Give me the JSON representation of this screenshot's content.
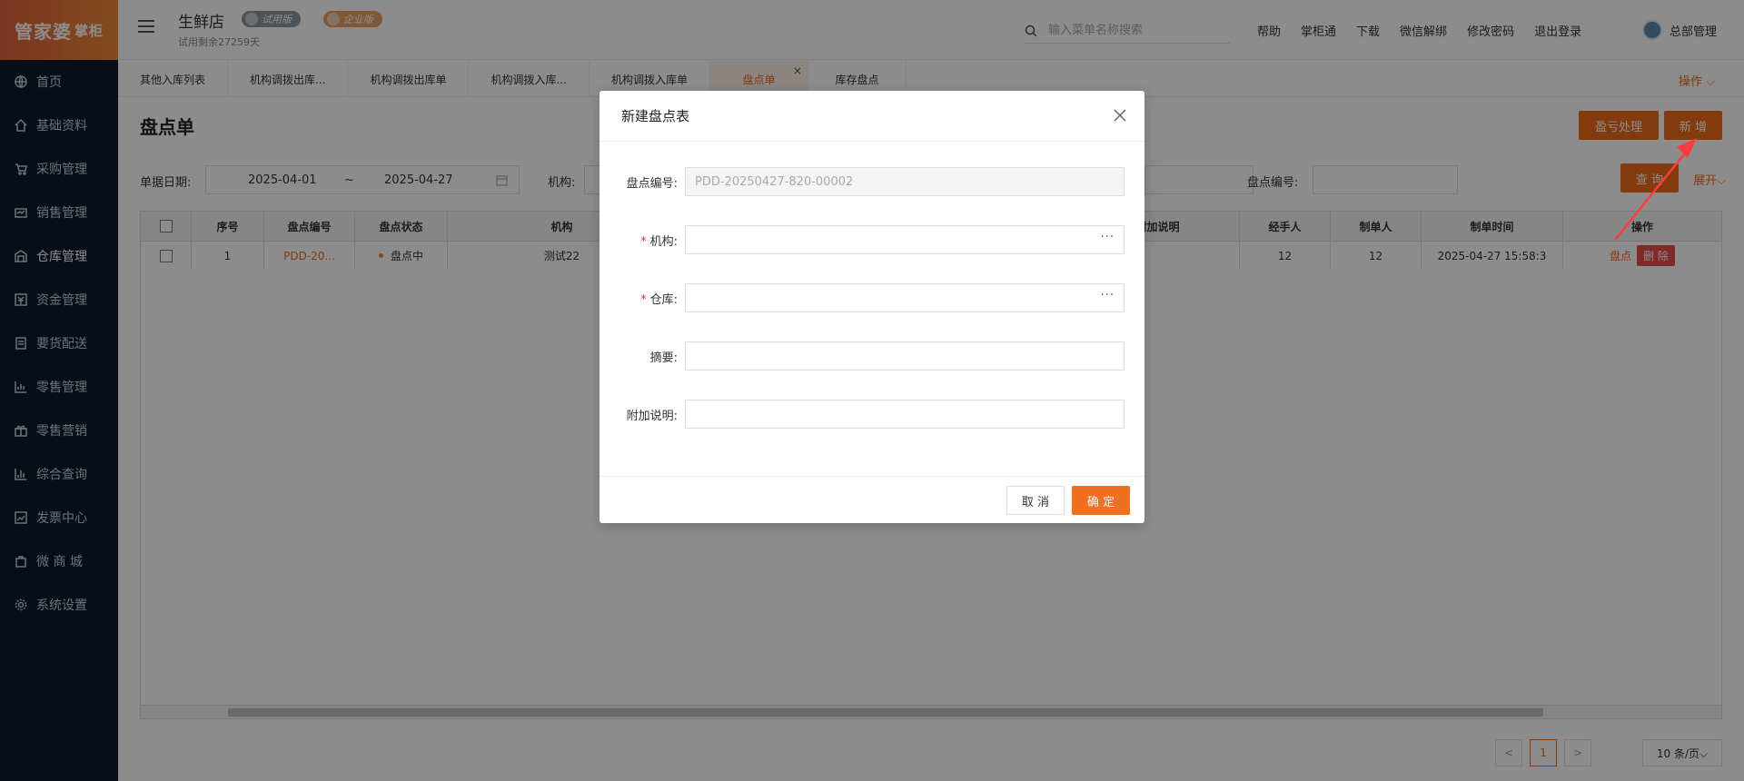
{
  "logo": {
    "main": "管家婆",
    "sub": "掌柜"
  },
  "sidebar": {
    "items": [
      {
        "label": "首页",
        "icon": "globe-icon"
      },
      {
        "label": "基础资料",
        "icon": "home-icon"
      },
      {
        "label": "采购管理",
        "icon": "cart-icon"
      },
      {
        "label": "销售管理",
        "icon": "sale-icon"
      },
      {
        "label": "仓库管理",
        "icon": "warehouse-icon"
      },
      {
        "label": "资金管理",
        "icon": "money-icon"
      },
      {
        "label": "要货配送",
        "icon": "delivery-icon"
      },
      {
        "label": "零售管理",
        "icon": "retail-chart-icon"
      },
      {
        "label": "零售营销",
        "icon": "gift-icon"
      },
      {
        "label": "综合查询",
        "icon": "bar-chart-icon"
      },
      {
        "label": "发票中心",
        "icon": "trend-icon"
      },
      {
        "label": "微 商 城",
        "icon": "bag-icon"
      },
      {
        "label": "系统设置",
        "icon": "gear-icon"
      }
    ]
  },
  "header": {
    "store_name": "生鲜店",
    "badge_trial": "试用版",
    "badge_enterprise": "企业版",
    "trial_remaining": "试用剩余27259天",
    "search_placeholder": "输入菜单名称搜索",
    "links": [
      "帮助",
      "掌柜通",
      "下载",
      "微信解绑",
      "修改密码",
      "退出登录"
    ],
    "user": "总部管理"
  },
  "tabs": {
    "items": [
      "其他入库列表",
      "机构调拨出库...",
      "机构调拨出库单",
      "机构调拨入库...",
      "机构调拨入库单",
      "盘点单",
      "库存盘点"
    ],
    "active_index": 5,
    "close_symbol": "×",
    "ops_label": "操作 ⌵"
  },
  "page": {
    "title": "盘点单",
    "btn_loss": "盈亏处理",
    "btn_add": "新 增",
    "btn_query": "查 询",
    "expand": "展开⌵",
    "filter": {
      "date_label": "单据日期:",
      "date_start": "2025-04-01",
      "date_sep": "~",
      "date_end": "2025-04-27",
      "org_label": "机构:",
      "code_label": "盘点编号:"
    }
  },
  "table": {
    "headers": [
      "序号",
      "盘点编号",
      "盘点状态",
      "机构",
      "",
      "附加说明",
      "经手人",
      "制单人",
      "制单时间",
      "操作"
    ],
    "rows": [
      {
        "index": "1",
        "code": "PDD-20...",
        "status": "盘点中",
        "org": "测试22",
        "col5": "",
        "note": "",
        "handler": "12",
        "maker": "12",
        "time": "2025-04-27 15:58:3",
        "op_check": "盘点",
        "op_delete": "删 除"
      }
    ]
  },
  "pagination": {
    "prev": "<",
    "current": "1",
    "next": ">",
    "page_size": "10 条/页⌵"
  },
  "modal": {
    "title": "新建盘点表",
    "fields": {
      "code_label": "盘点编号:",
      "code_value": "PDD-20250427-820-00002",
      "org_label": "机构:",
      "warehouse_label": "仓库:",
      "summary_label": "摘要:",
      "note_label": "附加说明:",
      "picker_symbol": "···",
      "required_mark": "*"
    },
    "cancel": "取 消",
    "confirm": "确 定"
  },
  "colors": {
    "accent": "#ee6a1a",
    "sidebar": "#0e1a2b",
    "danger": "#e84c4c"
  }
}
